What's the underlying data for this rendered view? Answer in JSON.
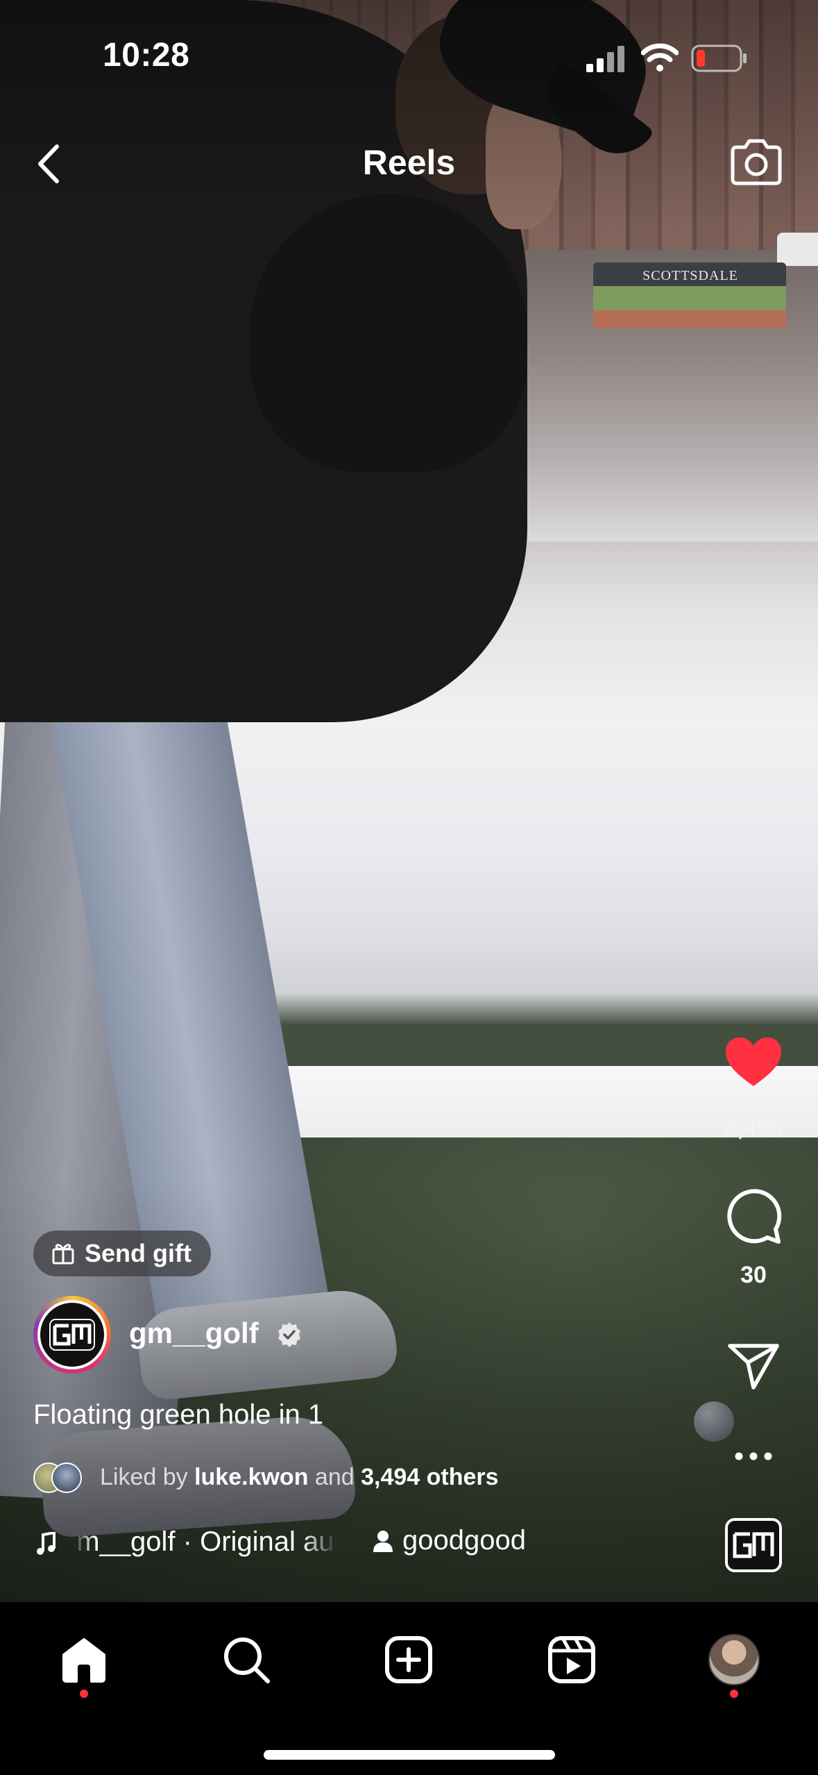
{
  "status_bar": {
    "time": "10:28"
  },
  "header": {
    "title": "Reels"
  },
  "background": {
    "sign_text": "SCOTTSDALE"
  },
  "actions": {
    "like_count": "3,495",
    "comment_count": "30",
    "like_color": "#ff3040"
  },
  "gift": {
    "label": "Send gift"
  },
  "author": {
    "username": "gm__golf",
    "verified": true,
    "avatar_text": "GM"
  },
  "caption": "Floating green hole in 1",
  "likes": {
    "prefix": "Liked by ",
    "user": "luke.kwon",
    "connector": " and ",
    "others": "3,494 others"
  },
  "audio": {
    "track": "gm__golf · Original audio"
  },
  "tagged": {
    "username": "goodgood"
  },
  "tab_bar": {
    "items": [
      "home",
      "search",
      "create",
      "reels",
      "profile"
    ],
    "notification_dot_color": "#ff3040"
  }
}
